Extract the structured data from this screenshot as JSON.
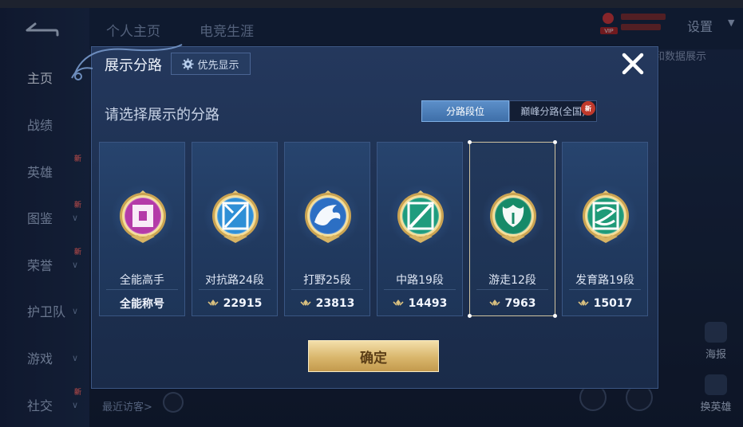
{
  "background": {
    "tabs": [
      "个人主页",
      "电竞生涯"
    ],
    "settings_label": "设置",
    "data_link": "和数据展示",
    "sidebar": [
      {
        "label": "主页",
        "active": true,
        "chevron": false,
        "new": false
      },
      {
        "label": "战绩",
        "active": false,
        "chevron": false,
        "new": false
      },
      {
        "label": "英雄",
        "active": false,
        "chevron": false,
        "new": true
      },
      {
        "label": "图鉴",
        "active": false,
        "chevron": true,
        "new": true
      },
      {
        "label": "荣誉",
        "active": false,
        "chevron": true,
        "new": true
      },
      {
        "label": "护卫队",
        "active": false,
        "chevron": true,
        "new": false
      },
      {
        "label": "游戏",
        "active": false,
        "chevron": true,
        "new": false
      },
      {
        "label": "社交",
        "active": false,
        "chevron": true,
        "new": true
      }
    ],
    "new_tag": "新",
    "vip_label": "VIP",
    "right_buttons": [
      "海报",
      "换英雄"
    ],
    "recent_visitors": "最近访客>"
  },
  "modal": {
    "title": "展示分路",
    "priority_button": "优先显示",
    "subtitle": "请选择展示的分路",
    "segments": [
      "分路段位",
      "巅峰分路(全国)"
    ],
    "active_segment": 0,
    "new_badge": "新",
    "confirm_button": "确定"
  },
  "lanes": [
    {
      "name": "全能高手",
      "footer": "全能称号",
      "points": null,
      "emblem": "all-round-icon",
      "color": "#b43aa8",
      "selected": false
    },
    {
      "name": "对抗路24段",
      "footer": "22915",
      "points": true,
      "emblem": "clash-lane-icon",
      "color": "#2f8fd6",
      "selected": false
    },
    {
      "name": "打野25段",
      "footer": "23813",
      "points": true,
      "emblem": "jungle-dragon-icon",
      "color": "#2c6fc4",
      "selected": false
    },
    {
      "name": "中路19段",
      "footer": "14493",
      "points": true,
      "emblem": "mid-lane-icon",
      "color": "#1f9c7e",
      "selected": false
    },
    {
      "name": "游走12段",
      "footer": "7963",
      "points": true,
      "emblem": "roam-icon",
      "color": "#168a68",
      "selected": true
    },
    {
      "name": "发育路19段",
      "footer": "15017",
      "points": true,
      "emblem": "farm-lane-icon",
      "color": "#1f9a78",
      "selected": false
    }
  ]
}
